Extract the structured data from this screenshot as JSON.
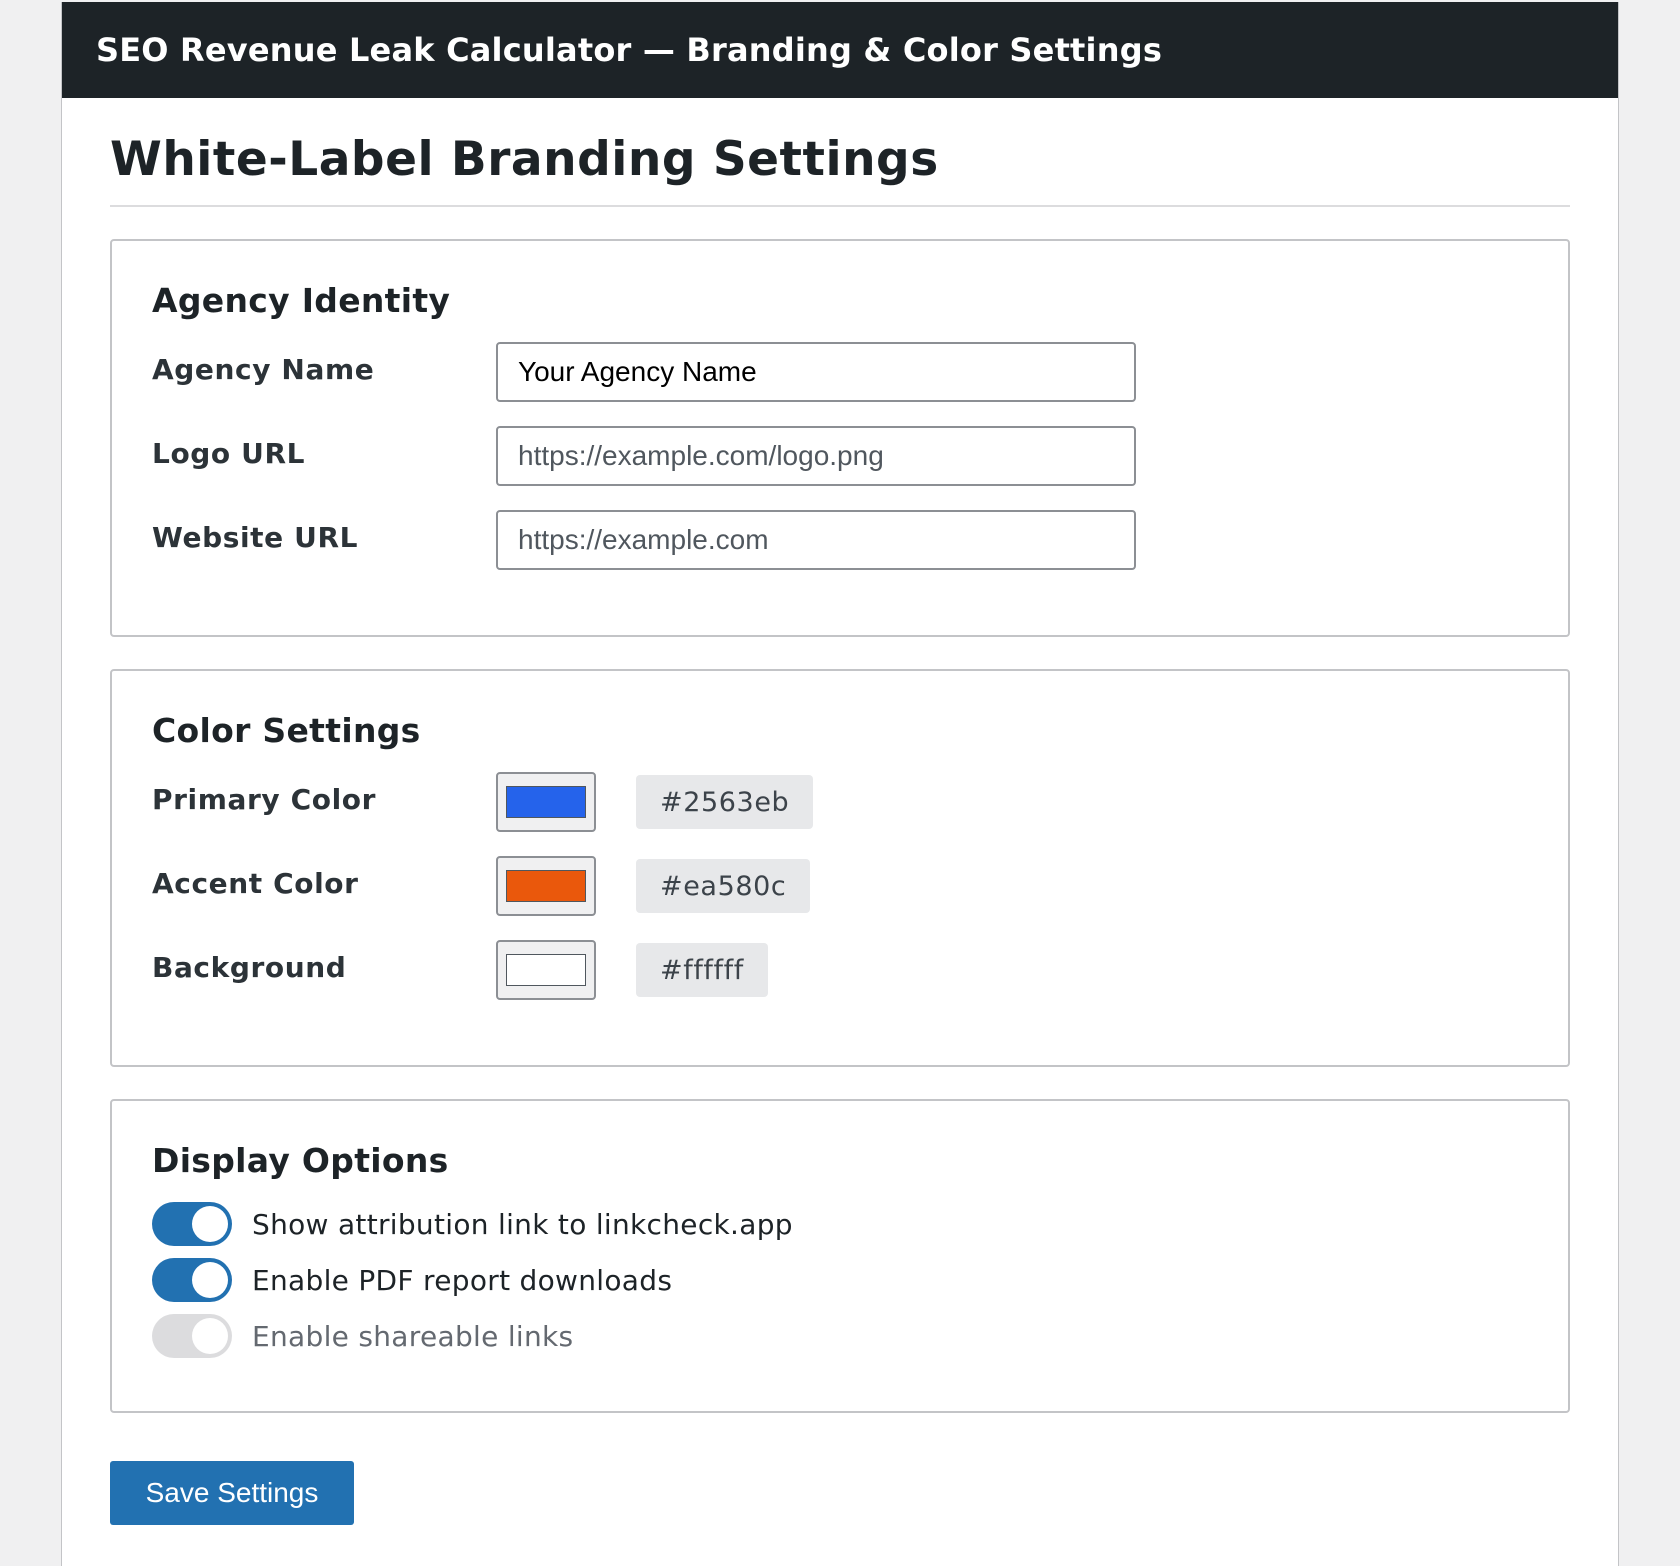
{
  "window": {
    "title": "SEO Revenue Leak Calculator — Branding & Color Settings"
  },
  "page": {
    "title": "White-Label Branding Settings"
  },
  "agency_identity": {
    "title": "Agency Identity",
    "fields": [
      {
        "label": "Agency Name",
        "value": "Your Agency Name",
        "placeholder": ""
      },
      {
        "label": "Logo URL",
        "value": "",
        "placeholder": "https://example.com/logo.png"
      },
      {
        "label": "Website URL",
        "value": "",
        "placeholder": "https://example.com"
      }
    ]
  },
  "color_settings": {
    "title": "Color Settings",
    "colors": [
      {
        "label": "Primary Color",
        "hex": "#2563eb"
      },
      {
        "label": "Accent Color",
        "hex": "#ea580c"
      },
      {
        "label": "Background",
        "hex": "#ffffff"
      }
    ]
  },
  "display_options": {
    "title": "Display Options",
    "toggles": [
      {
        "label": "Show attribution link to linkcheck.app",
        "enabled": true
      },
      {
        "label": "Enable PDF report downloads",
        "enabled": true
      },
      {
        "label": "Enable shareable links",
        "enabled": false
      }
    ]
  },
  "actions": {
    "save_label": "Save Settings"
  },
  "theme": {
    "titlebar_bg": "#1d2327",
    "button_blue": "#2271b1"
  }
}
